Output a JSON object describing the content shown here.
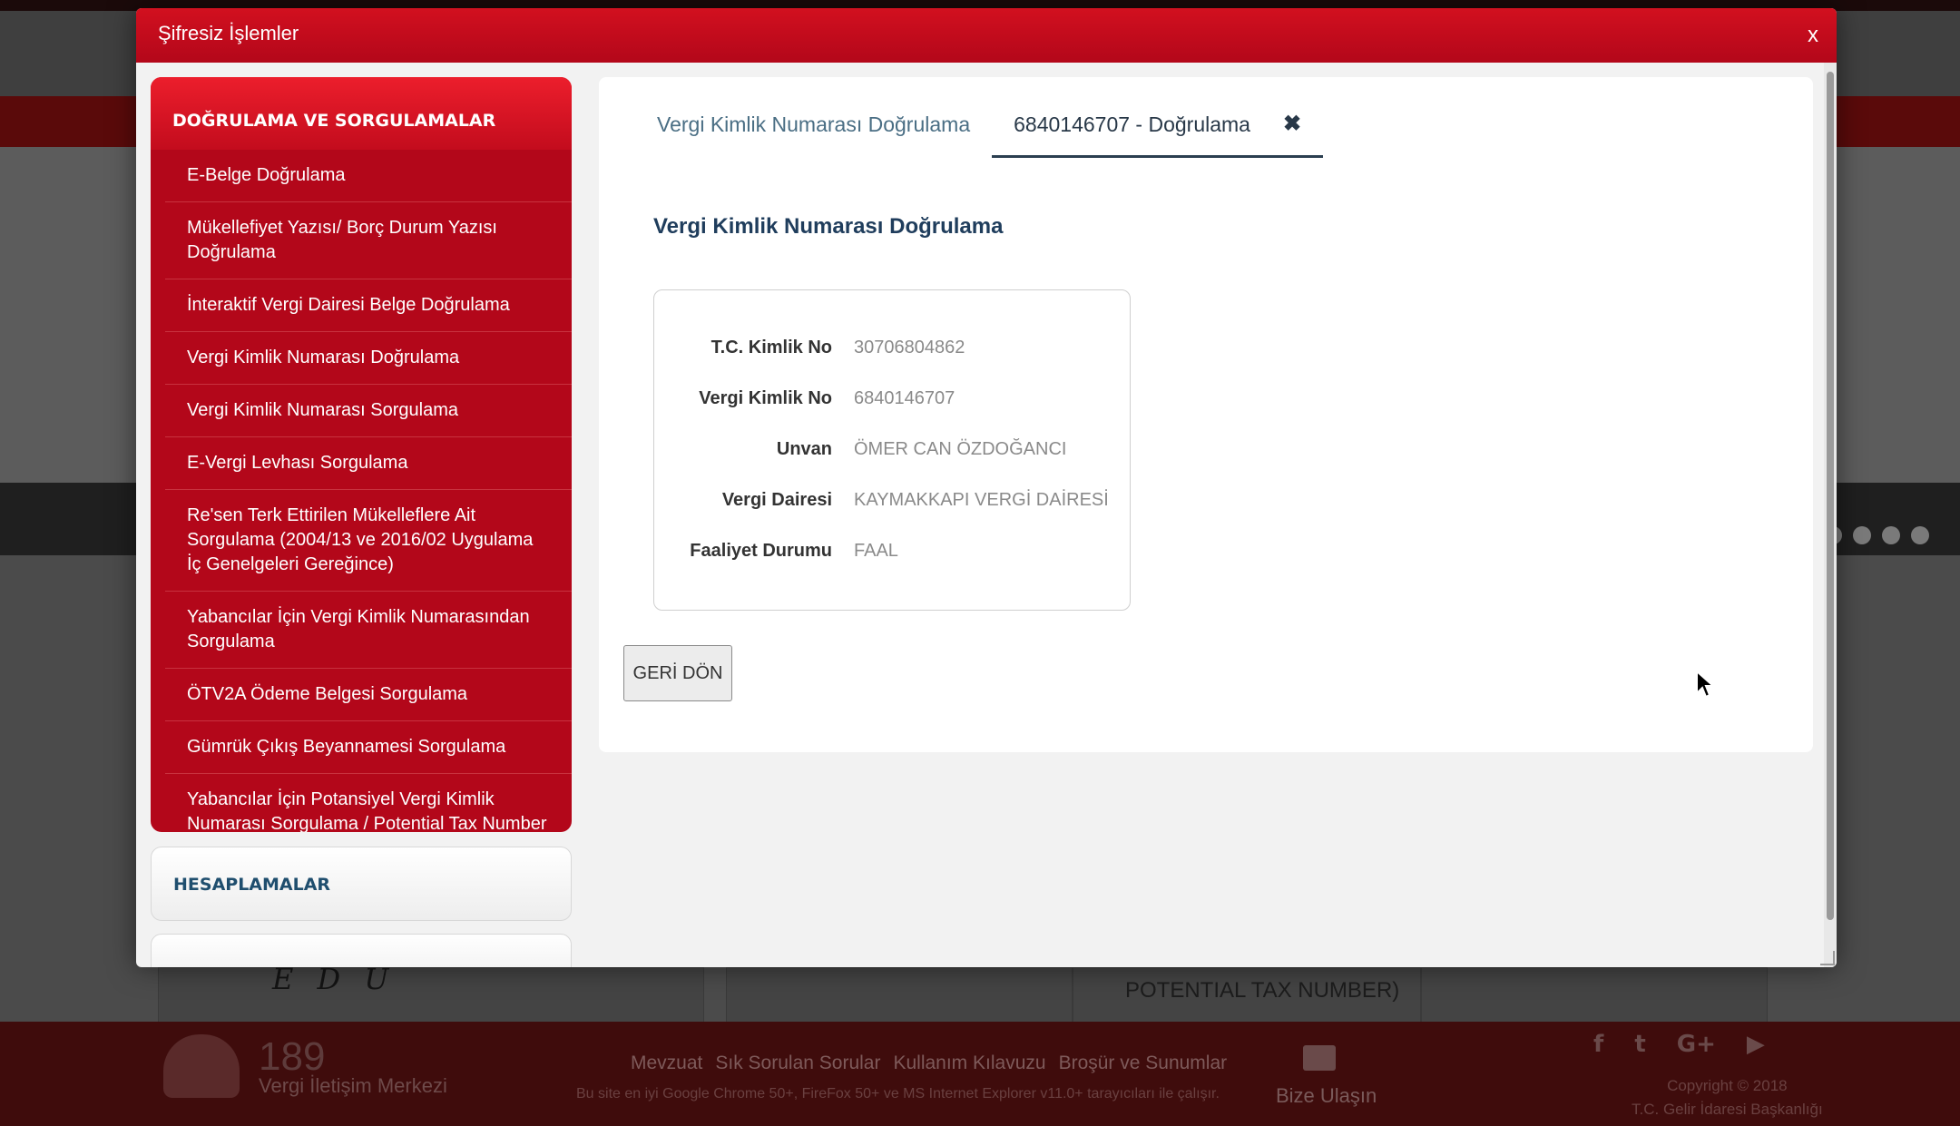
{
  "modal": {
    "title": "Şifresiz İşlemler",
    "close": "x"
  },
  "sidebar": {
    "group1_title": "DOĞRULAMA VE SORGULAMALAR",
    "items": [
      {
        "label": "E-Belge Doğrulama"
      },
      {
        "label": "Mükellefiyet Yazısı/ Borç Durum Yazısı Doğrulama"
      },
      {
        "label": "İnteraktif Vergi Dairesi Belge Doğrulama"
      },
      {
        "label": "Vergi Kimlik Numarası Doğrulama"
      },
      {
        "label": "Vergi Kimlik Numarası Sorgulama"
      },
      {
        "label": "E-Vergi Levhası Sorgulama"
      },
      {
        "label": "Re'sen Terk Ettirilen Mükelleflere Ait Sorgulama (2004/13 ve 2016/02 Uygulama İç Genelgeleri Gereğince)"
      },
      {
        "label": "Yabancılar İçin Vergi Kimlik Numarasından Sorgulama"
      },
      {
        "label": "ÖTV2A Ödeme Belgesi Sorgulama"
      },
      {
        "label": "Gümrük Çıkış Beyannamesi Sorgulama"
      },
      {
        "label": "Yabancılar İçin Potansiyel Vergi Kimlik Numarası Sorgulama / Potential Tax Number Confirmation for Foreigners"
      }
    ],
    "group2_title": "HESAPLAMALAR"
  },
  "tabs": [
    {
      "label": "Vergi Kimlik Numarası Doğrulama"
    },
    {
      "label": "6840146707 - Doğrulama",
      "close": "✖"
    }
  ],
  "section_title": "Vergi Kimlik Numarası Doğrulama",
  "details": [
    {
      "key": "T.C. Kimlik No",
      "value": "30706804862"
    },
    {
      "key": "Vergi Kimlik No",
      "value": "6840146707"
    },
    {
      "key": "Unvan",
      "value": "ÖMER CAN ÖZDOĞANCI"
    },
    {
      "key": "Vergi Dairesi",
      "value": "KAYMAKKAPI VERGİ DAİRESİ"
    },
    {
      "key": "Faaliyet Durumu",
      "value": "FAAL"
    }
  ],
  "back_button": "GERİ DÖN",
  "background": {
    "potential_text": "POTENTIAL TAX NUMBER)",
    "edu_text": "E D U",
    "footer": {
      "phone_number": "189",
      "phone_label": "Vergi İletişim Merkezi",
      "links": [
        "Mevzuat",
        "Sık Sorulan Sorular",
        "Kullanım Kılavuzu",
        "Broşür ve Sunumlar"
      ],
      "browser_note": "Bu site en iyi Google Chrome 50+, FireFox 50+ ve MS Internet Explorer v11.0+ tarayıcıları ile çalışır.",
      "contact": "Bize Ulaşın",
      "copyright_line1": "Copyright © 2018",
      "copyright_line2": "T.C. Gelir İdaresi Başkanlığı",
      "social": [
        "f",
        "t",
        "G+",
        "▶"
      ]
    }
  },
  "colors": {
    "primary_red": "#b3071a",
    "header_red": "#d2101f",
    "link_blue": "#1f4e6e"
  }
}
